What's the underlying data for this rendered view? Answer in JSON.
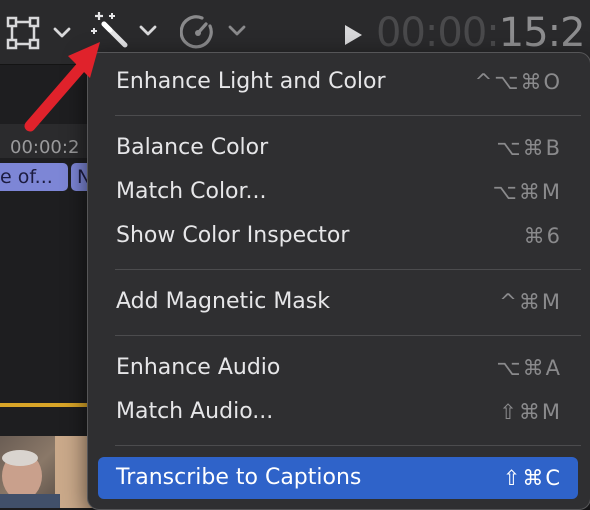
{
  "toolbar": {
    "timecode_dim": "00:00:",
    "timecode_bright": "15:2"
  },
  "timeline": {
    "ruler_label": "00:00:2",
    "clips": [
      "e of...",
      "N"
    ]
  },
  "menu": {
    "items": [
      {
        "label": "Enhance Light and Color",
        "shortcut": "^⌥⌘O"
      },
      {
        "label": "Balance Color",
        "shortcut": "⌥⌘B"
      },
      {
        "label": "Match Color...",
        "shortcut": "⌥⌘M"
      },
      {
        "label": "Show Color Inspector",
        "shortcut": "⌘6"
      },
      {
        "label": "Add Magnetic Mask",
        "shortcut": "^⌘M"
      },
      {
        "label": "Enhance Audio",
        "shortcut": "⌥⌘A"
      },
      {
        "label": "Match Audio...",
        "shortcut": "⇧⌘M"
      },
      {
        "label": "Transcribe to Captions",
        "shortcut": "⇧⌘C"
      }
    ]
  },
  "colors": {
    "menu_bg": "#2f2f31",
    "selection": "#2f63c9",
    "annotation_arrow": "#e0222b",
    "clip": "#7d86d6",
    "track_accent": "#d9a528"
  }
}
